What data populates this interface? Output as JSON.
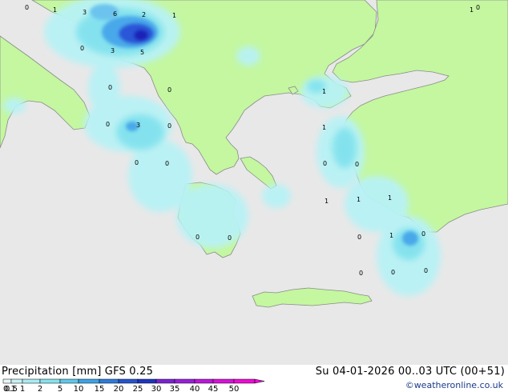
{
  "title": "Precipitation [mm]  GFS 0.25",
  "datetime": "Su 04-01-2026 00..03 UTC (00+51)",
  "credit": "©weatheronline.co.uk",
  "colors": {
    "sea": "#e8e8e8",
    "land": "#c4f7a0",
    "coast": "#8a8a8a",
    "precip_light": "#b8f2f5",
    "precip_mid": "#82e2ee",
    "precip_strong": "#4aa8ea",
    "precip_heavy": "#2a56d8",
    "precip_max": "#1a24b8"
  },
  "legend": {
    "labels": [
      "0.1",
      "0.5",
      "1",
      "2",
      "5",
      "10",
      "15",
      "20",
      "25",
      "30",
      "35",
      "40",
      "45",
      "50"
    ],
    "colors": [
      "#e8f8f8",
      "#c8f2f4",
      "#a8ecf2",
      "#86e2ee",
      "#5ec8ec",
      "#3aa4e6",
      "#2c7cdc",
      "#2454d0",
      "#1e34c2",
      "#7a22d4",
      "#9a1edc",
      "#be16de",
      "#da10dc",
      "#f00ad6"
    ]
  },
  "map_values": [
    "0",
    "1",
    "3",
    "6",
    "2",
    "1",
    "1",
    "0",
    "0",
    "3",
    "5",
    "0",
    "0",
    "0",
    "3",
    "0",
    "0",
    "0",
    "1",
    "1",
    "0",
    "0",
    "1",
    "1",
    "1",
    "0",
    "0",
    "0",
    "1",
    "0",
    "0",
    "0",
    "0"
  ]
}
